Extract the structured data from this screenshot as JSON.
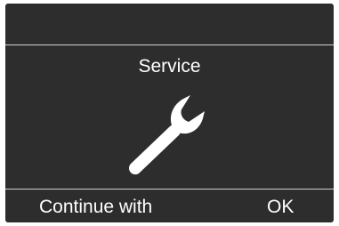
{
  "screen": {
    "title": "Service",
    "icon": "wrench-icon"
  },
  "softkeys": {
    "left_label": "Continue with",
    "right_label": "OK"
  },
  "colors": {
    "background": "#2d2d2d",
    "foreground": "#ffffff",
    "divider": "#d0d0d0"
  }
}
